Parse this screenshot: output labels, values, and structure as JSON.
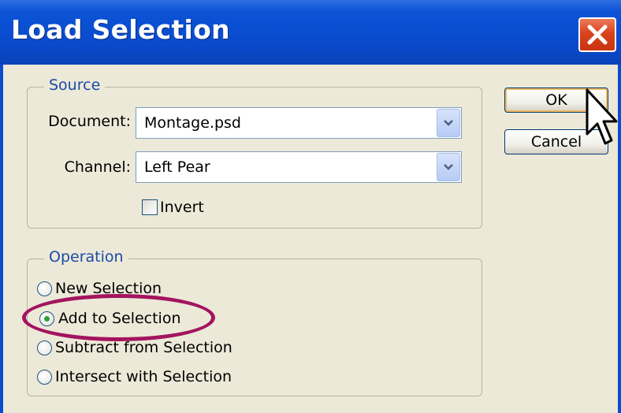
{
  "window": {
    "title": "Load Selection"
  },
  "source": {
    "legend": "Source",
    "document_label": "Document:",
    "document_value": "Montage.psd",
    "channel_label": "Channel:",
    "channel_value": "Left Pear",
    "invert_label": "Invert",
    "invert_checked": false
  },
  "operation": {
    "legend": "Operation",
    "options": [
      {
        "label": "New Selection",
        "selected": false
      },
      {
        "label": "Add to Selection",
        "selected": true
      },
      {
        "label": "Subtract from Selection",
        "selected": false
      },
      {
        "label": "Intersect with Selection",
        "selected": false
      }
    ]
  },
  "buttons": {
    "ok": "OK",
    "cancel": "Cancel"
  },
  "icons": {
    "close": "close-icon",
    "dropdown": "chevron-down-icon",
    "cursor": "mouse-pointer-icon"
  },
  "colors": {
    "titlebar": "#0a4cd0",
    "close": "#d9431c",
    "highlight": "#a3145f",
    "legend_text": "#1a4aa8"
  }
}
